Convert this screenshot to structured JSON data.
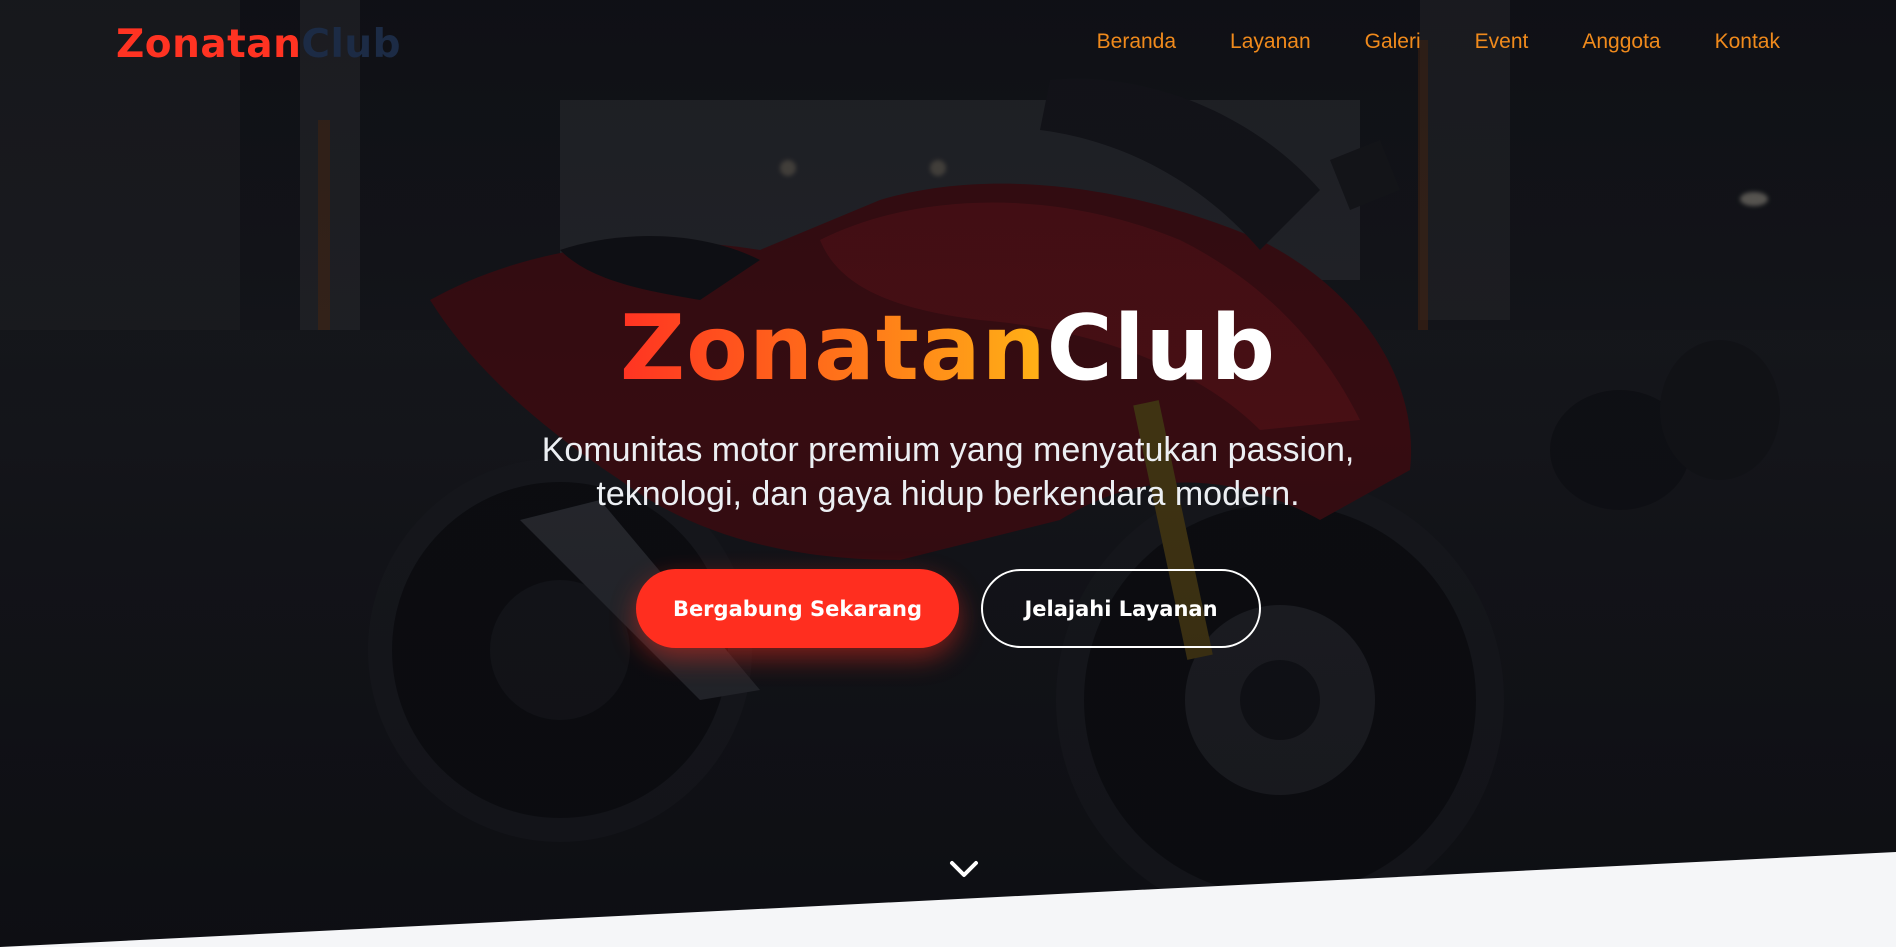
{
  "nav": {
    "logo_part1": "Zonatan",
    "logo_part2": "Club",
    "items": [
      "Beranda",
      "Layanan",
      "Galeri",
      "Event",
      "Anggota",
      "Kontak"
    ]
  },
  "hero": {
    "title_part1": "Zonatan",
    "title_part2": "Club",
    "subtitle_line1": "Komunitas motor premium yang menyatukan passion,",
    "subtitle_line2": "teknologi, dan gaya hidup berkendara modern.",
    "primary_button": "Bergabung Sekarang",
    "secondary_button": "Jelajahi Layanan",
    "scroll_icon": "chevron-down-icon"
  },
  "colors": {
    "accent_red": "#ff2e1f",
    "accent_orange": "#f08a1c",
    "gradient_yellow": "#ffb216",
    "logo_dark": "#1c2b45",
    "section_bg": "#f5f6f8"
  }
}
